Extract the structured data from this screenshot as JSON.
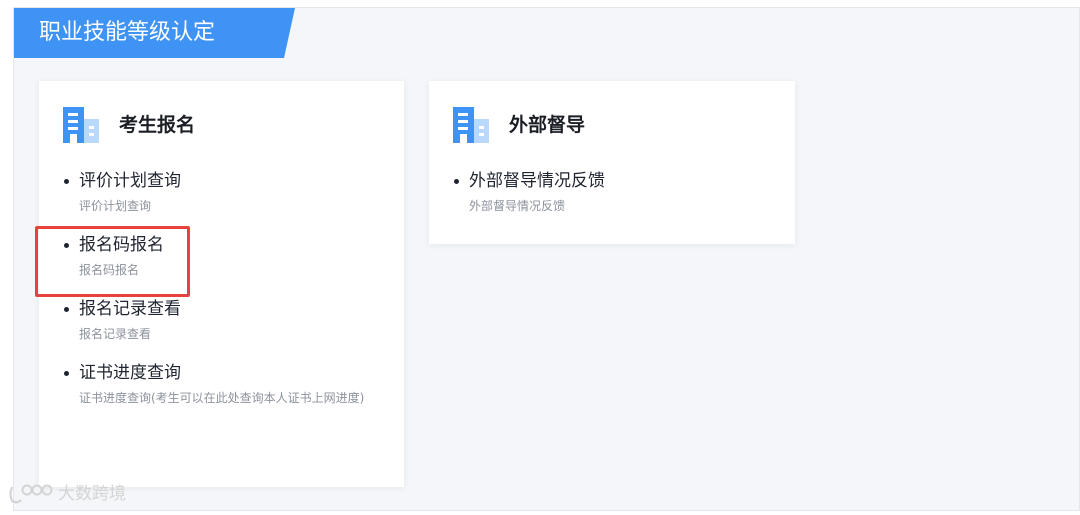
{
  "header": {
    "title": "职业技能等级认定"
  },
  "cards": [
    {
      "title": "考生报名",
      "icon": "building-icon",
      "items": [
        {
          "label": "评价计划查询",
          "desc": "评价计划查询"
        },
        {
          "label": "报名码报名",
          "desc": "报名码报名"
        },
        {
          "label": "报名记录查看",
          "desc": "报名记录查看"
        },
        {
          "label": "证书进度查询",
          "desc": "证书进度查询(考生可以在此处查询本人证书上网进度)"
        }
      ]
    },
    {
      "title": "外部督导",
      "icon": "building-icon",
      "items": [
        {
          "label": "外部督导情况反馈",
          "desc": "外部督导情况反馈"
        }
      ]
    }
  ],
  "annotation": {
    "highlighted_item": "报名码报名",
    "color": "#e8423e"
  },
  "watermark": {
    "text": "大数跨境"
  },
  "colors": {
    "accent": "#3f93f4",
    "background": "#f4f6f9"
  }
}
